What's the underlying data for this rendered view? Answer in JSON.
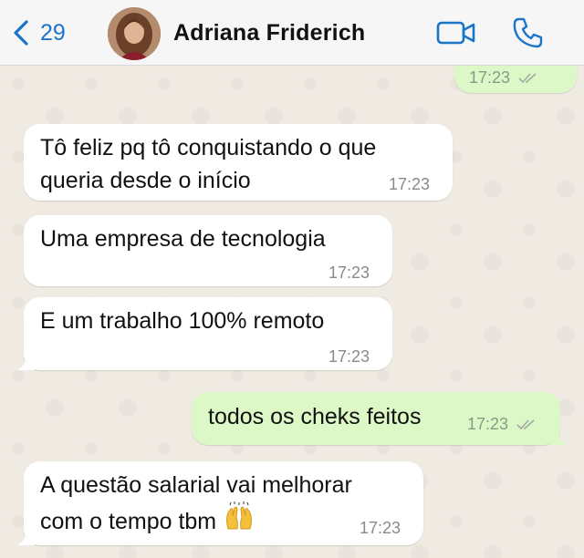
{
  "header": {
    "back_count": "29",
    "contact_name": "Adriana Friderich",
    "icons": [
      "chevron-left-icon",
      "video-call-icon",
      "phone-icon"
    ]
  },
  "colors": {
    "accent": "#1a75c9",
    "incoming_bubble": "#ffffff",
    "outgoing_bubble": "#dcf8c6",
    "chat_background": "#efeae2"
  },
  "messages": [
    {
      "direction": "out",
      "text": "",
      "time": "17:23",
      "read": true
    },
    {
      "direction": "in",
      "lines": [
        "Tô feliz pq tô conquistando o que",
        "queria desde o início"
      ],
      "time": "17:23"
    },
    {
      "direction": "in",
      "text": "Uma empresa de tecnologia",
      "time": "17:23"
    },
    {
      "direction": "in",
      "text": "E um trabalho 100% remoto",
      "time": "17:23"
    },
    {
      "direction": "out",
      "text": "todos os cheks feitos",
      "time": "17:23",
      "read": true
    },
    {
      "direction": "in",
      "lines": [
        "A questão salarial vai melhorar",
        "com o tempo tbm"
      ],
      "emoji": "raising-hands-emoji",
      "time": "17:23"
    }
  ]
}
